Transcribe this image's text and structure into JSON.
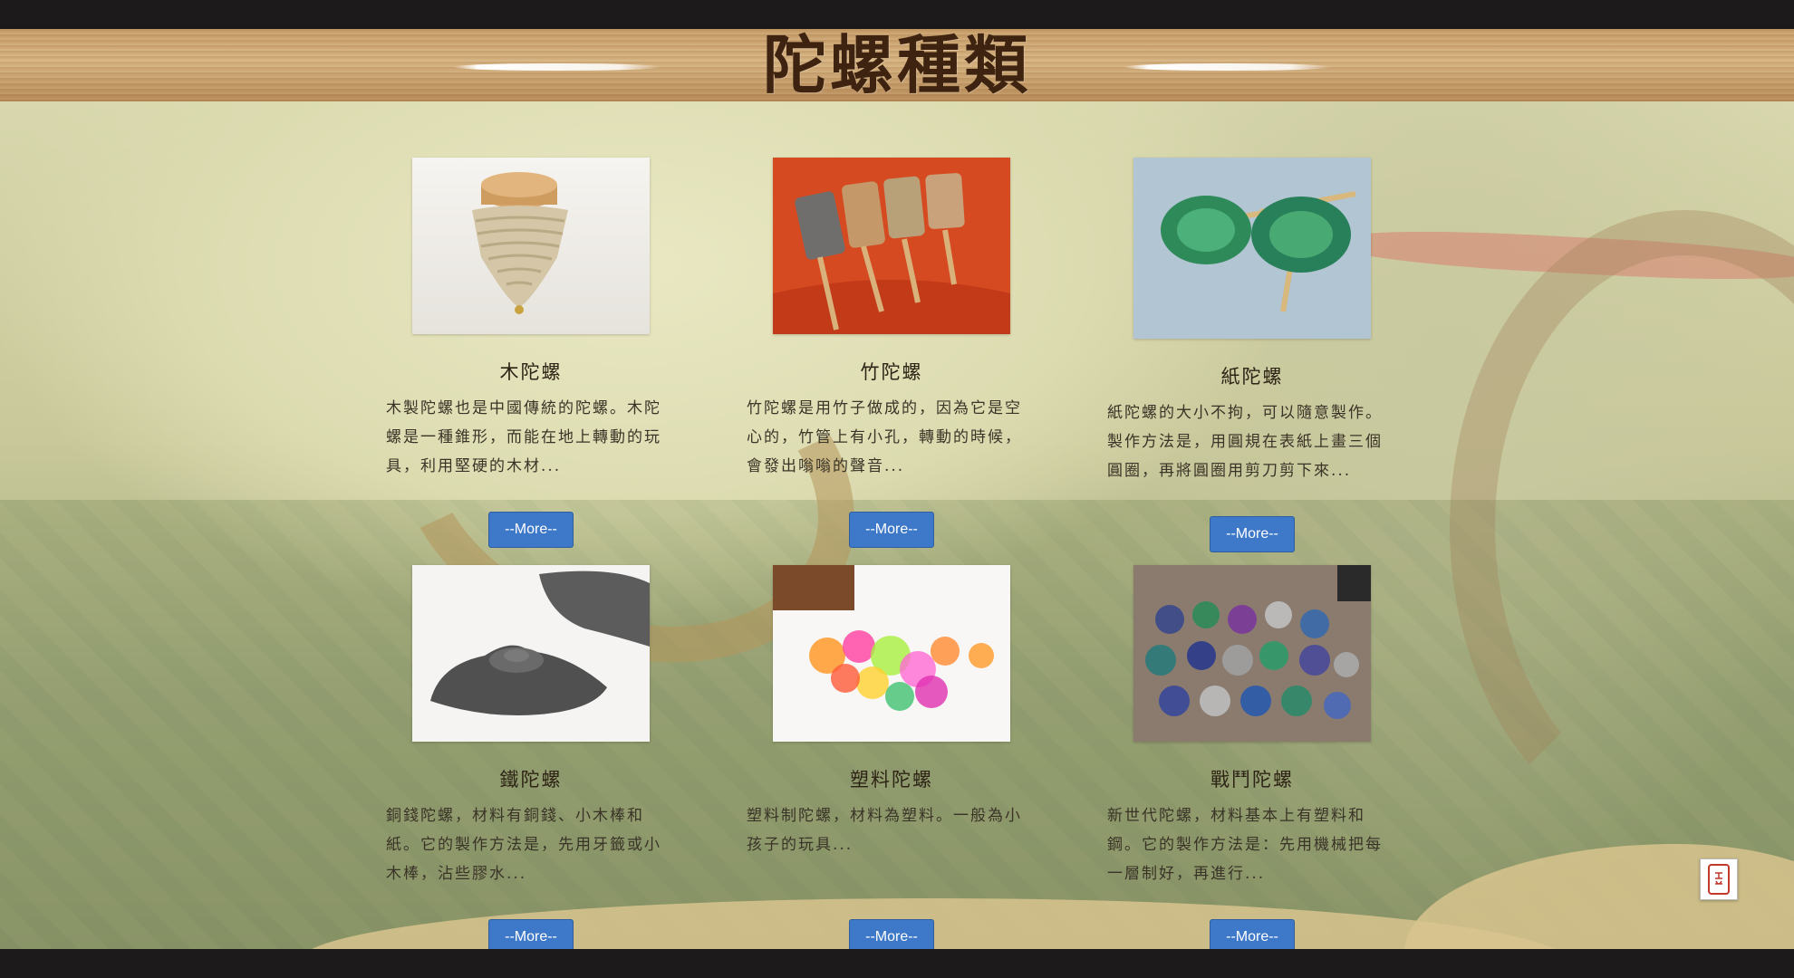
{
  "header": {
    "title": "陀螺種類"
  },
  "cards": [
    {
      "title": "木陀螺",
      "description": "木製陀螺也是中國傳統的陀螺。木陀螺是一種錐形，而能在地上轉動的玩具，利用堅硬的木材...",
      "more_label": "--More--",
      "image": "wooden-top-photo"
    },
    {
      "title": "竹陀螺",
      "description": "竹陀螺是用竹子做成的，因為它是空心的，竹管上有小孔，轉動的時候，會發出嗡嗡的聲音...",
      "more_label": "--More--",
      "image": "bamboo-top-photo"
    },
    {
      "title": "紙陀螺",
      "description": "紙陀螺的大小不拘，可以隨意製作。製作方法是，用圓規在表紙上畫三個圓圈，再將圓圈用剪刀剪下來...",
      "more_label": "--More--",
      "image": "paper-top-photo"
    },
    {
      "title": "鐵陀螺",
      "description": "銅錢陀螺，材料有銅錢、小木棒和紙。它的製作方法是，先用牙籤或小木棒，沾些膠水...",
      "more_label": "--More--",
      "image": "iron-top-photo"
    },
    {
      "title": "塑料陀螺",
      "description": "塑料制陀螺，材料為塑料。一般為小孩子的玩具...",
      "more_label": "--More--",
      "image": "plastic-top-photo"
    },
    {
      "title": "戰鬥陀螺",
      "description": "新世代陀螺，材料基本上有塑料和鋼。它的製作方法是：先用機械把每一層制好，再進行...",
      "more_label": "--More--",
      "image": "battle-top-photo"
    }
  ],
  "seal_button": {
    "icon": "red-seal-icon"
  },
  "colors": {
    "button_blue": "#3e78c8",
    "title_brown": "#3e2410",
    "wood": "#d9b683"
  }
}
